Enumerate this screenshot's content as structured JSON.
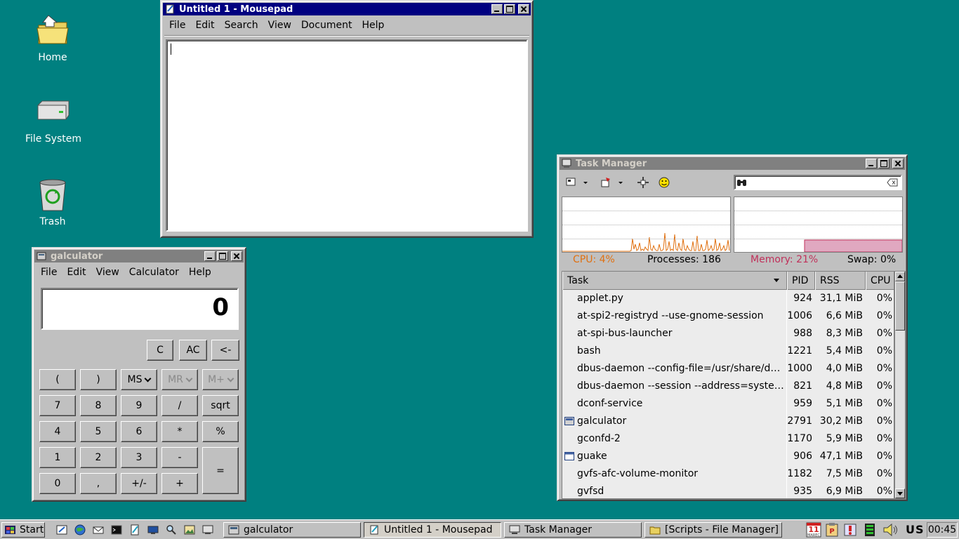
{
  "desktop": {
    "icons": [
      {
        "label": "Home",
        "icon": "home-folder-icon"
      },
      {
        "label": "File System",
        "icon": "drive-icon"
      },
      {
        "label": "Trash",
        "icon": "trash-icon"
      }
    ]
  },
  "mousepad": {
    "title": "Untitled 1 - Mousepad",
    "menu": [
      "File",
      "Edit",
      "Search",
      "View",
      "Document",
      "Help"
    ],
    "content": ""
  },
  "galculator": {
    "title": "galculator",
    "menu": [
      "File",
      "Edit",
      "View",
      "Calculator",
      "Help"
    ],
    "display": "0",
    "buttons": {
      "clear": "C",
      "all_clear": "AC",
      "backspace": "<-",
      "paren_open": "(",
      "paren_close": ")",
      "ms": "MS",
      "mr": "MR",
      "mplus": "M+",
      "seven": "7",
      "eight": "8",
      "nine": "9",
      "divide": "/",
      "sqrt": "sqrt",
      "four": "4",
      "five": "5",
      "six": "6",
      "multiply": "*",
      "percent": "%",
      "one": "1",
      "two": "2",
      "three": "3",
      "minus": "-",
      "equals": "=",
      "zero": "0",
      "comma": ",",
      "sign": "+/-",
      "plus": "+"
    }
  },
  "taskmanager": {
    "title": "Task Manager",
    "search_value": "",
    "stats": {
      "cpu": "CPU: 4%",
      "processes": "Processes: 186",
      "memory": "Memory: 21%",
      "swap": "Swap: 0%"
    },
    "colors": {
      "cpu": "#e07010",
      "memory": "#c0305a",
      "memory_fill": "#e0a8c0"
    },
    "columns": {
      "task": "Task",
      "pid": "PID",
      "rss": "RSS",
      "cpu": "CPU"
    },
    "rows": [
      {
        "name": "applet.py",
        "pid": "924",
        "rss": "31,1 MiB",
        "cpu": "0%"
      },
      {
        "name": "at-spi2-registryd --use-gnome-session",
        "pid": "1006",
        "rss": "6,6 MiB",
        "cpu": "0%"
      },
      {
        "name": "at-spi-bus-launcher",
        "pid": "988",
        "rss": "8,3 MiB",
        "cpu": "0%"
      },
      {
        "name": "bash",
        "pid": "1221",
        "rss": "5,4 MiB",
        "cpu": "0%"
      },
      {
        "name": "dbus-daemon --config-file=/usr/share/defa…",
        "pid": "1000",
        "rss": "4,0 MiB",
        "cpu": "0%"
      },
      {
        "name": "dbus-daemon --session --address=system…",
        "pid": "821",
        "rss": "4,8 MiB",
        "cpu": "0%"
      },
      {
        "name": "dconf-service",
        "pid": "959",
        "rss": "5,1 MiB",
        "cpu": "0%"
      },
      {
        "name": "galculator",
        "pid": "2791",
        "rss": "30,2 MiB",
        "cpu": "0%"
      },
      {
        "name": "gconfd-2",
        "pid": "1170",
        "rss": "5,9 MiB",
        "cpu": "0%"
      },
      {
        "name": "guake",
        "pid": "906",
        "rss": "47,1 MiB",
        "cpu": "0%"
      },
      {
        "name": "gvfs-afc-volume-monitor",
        "pid": "1182",
        "rss": "7,5 MiB",
        "cpu": "0%"
      },
      {
        "name": "gvfsd",
        "pid": "935",
        "rss": "6,9 MiB",
        "cpu": "0%"
      }
    ]
  },
  "taskbar": {
    "start_label": "Start",
    "tasks": [
      {
        "label": "galculator"
      },
      {
        "label": "Untitled 1 - Mousepad"
      },
      {
        "label": "Task Manager"
      },
      {
        "label": "[Scripts - File Manager]"
      }
    ],
    "calendar_day": "11",
    "calendar_month": "MAREC",
    "keyboard_layout": "US",
    "clock": "00:45"
  }
}
